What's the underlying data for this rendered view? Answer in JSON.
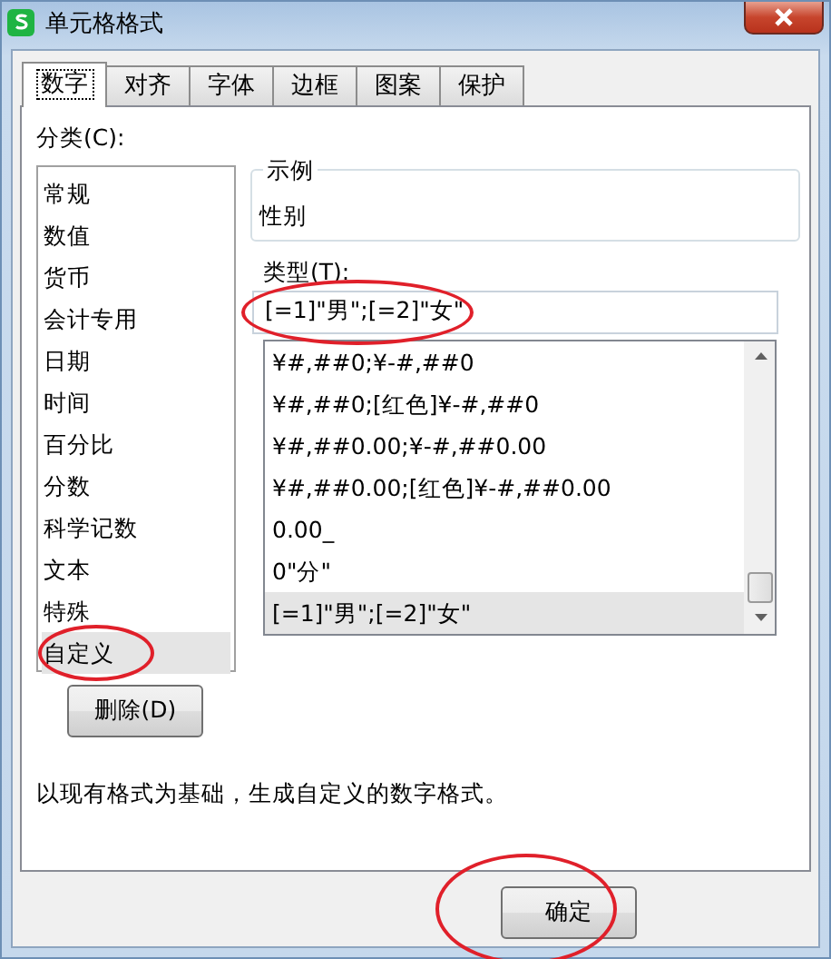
{
  "window": {
    "title": "单元格格式"
  },
  "tabs": [
    {
      "label": "数字",
      "selected": true
    },
    {
      "label": "对齐",
      "selected": false
    },
    {
      "label": "字体",
      "selected": false
    },
    {
      "label": "边框",
      "selected": false
    },
    {
      "label": "图案",
      "selected": false
    },
    {
      "label": "保护",
      "selected": false
    }
  ],
  "category_label": "分类(C):",
  "categories": [
    {
      "label": "常规",
      "selected": false
    },
    {
      "label": "数值",
      "selected": false
    },
    {
      "label": "货币",
      "selected": false
    },
    {
      "label": "会计专用",
      "selected": false
    },
    {
      "label": "日期",
      "selected": false
    },
    {
      "label": "时间",
      "selected": false
    },
    {
      "label": "百分比",
      "selected": false
    },
    {
      "label": "分数",
      "selected": false
    },
    {
      "label": "科学记数",
      "selected": false
    },
    {
      "label": "文本",
      "selected": false
    },
    {
      "label": "特殊",
      "selected": false
    },
    {
      "label": "自定义",
      "selected": true,
      "circled": true
    }
  ],
  "example": {
    "title": "示例",
    "value": "性别"
  },
  "type_label": "类型(T):",
  "type_field": {
    "value": "[=1]\"男\";[=2]\"女\"",
    "circled": true
  },
  "formats": [
    {
      "label": "¥#,##0;¥-#,##0",
      "selected": false
    },
    {
      "label": "¥#,##0;[红色]¥-#,##0",
      "selected": false
    },
    {
      "label": "¥#,##0.00;¥-#,##0.00",
      "selected": false
    },
    {
      "label": "¥#,##0.00;[红色]¥-#,##0.00",
      "selected": false
    },
    {
      "label": "0.00_",
      "selected": false
    },
    {
      "label": "0\"分\"",
      "selected": false
    },
    {
      "label": "[=1]\"男\";[=2]\"女\"",
      "selected": true
    }
  ],
  "delete_button": "删除(D)",
  "description": "以现有格式为基础，生成自定义的数字格式。",
  "buttons": [
    {
      "label": "确定",
      "circled": true
    }
  ]
}
